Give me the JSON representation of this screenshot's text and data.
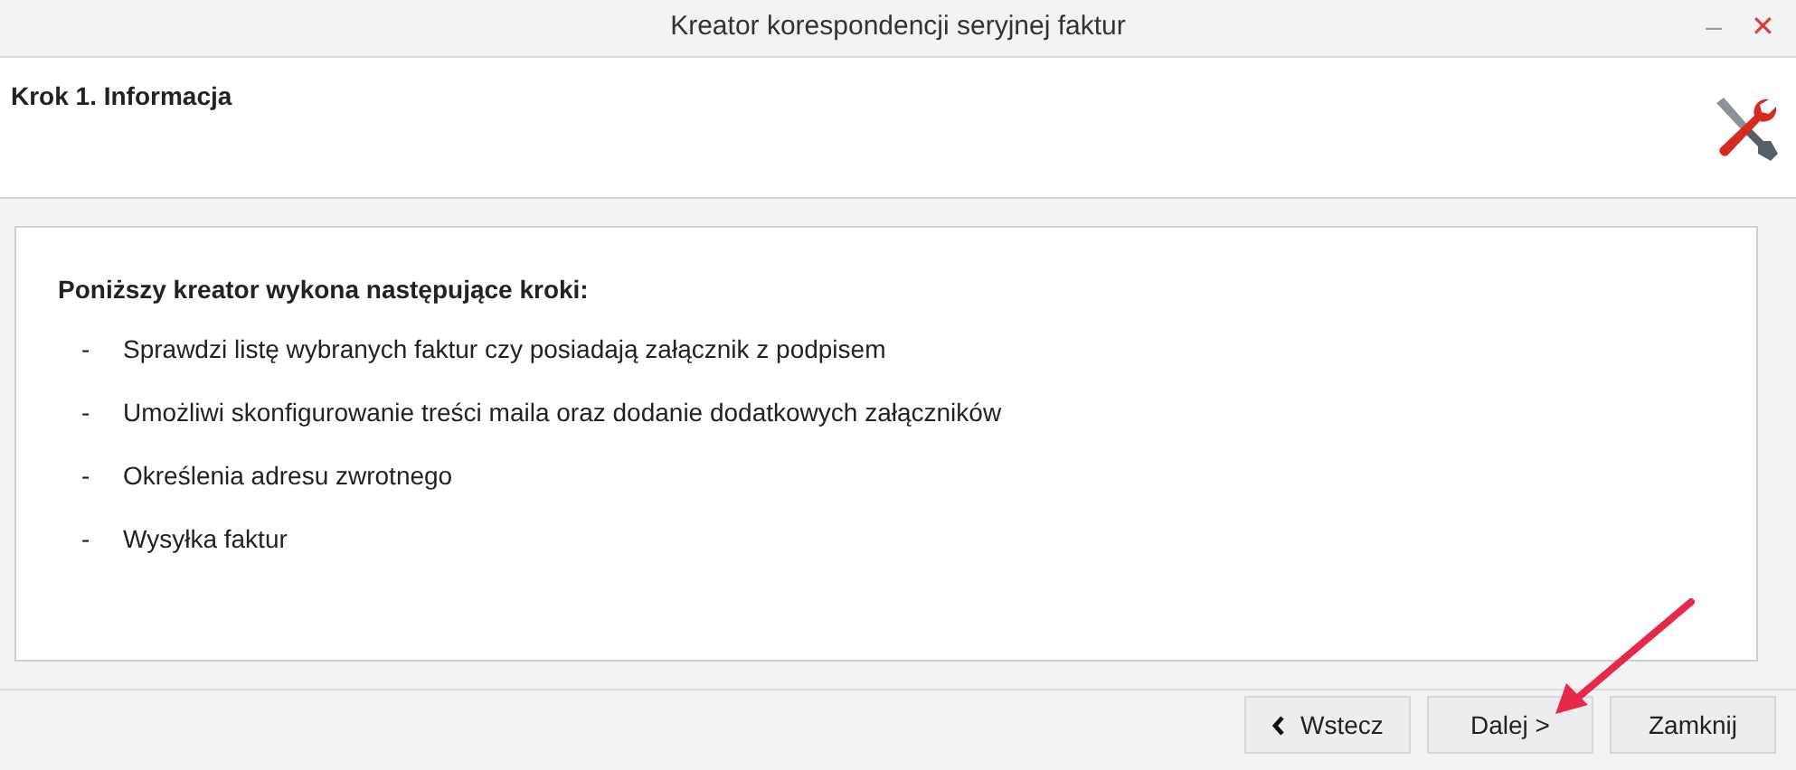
{
  "window": {
    "title": "Kreator korespondencji seryjnej faktur",
    "controls": [
      "–",
      "✕"
    ]
  },
  "step": {
    "title": "Krok 1. Informacja"
  },
  "content": {
    "heading": "Poniższy kreator wykona następujące kroki:",
    "items": [
      {
        "bullet": "-",
        "text": "Sprawdzi listę wybranych faktur czy posiadają załącznik z podpisem"
      },
      {
        "bullet": "-",
        "text": "Umożliwi skonfigurowanie treści maila oraz dodanie dodatkowych załączników"
      },
      {
        "bullet": "-",
        "text": "Określenia adresu zwrotnego"
      },
      {
        "bullet": "-",
        "text": "Wysyłka faktur"
      }
    ]
  },
  "buttons": [
    {
      "label": "Wstecz",
      "kind": "back"
    },
    {
      "label": "Dalej >",
      "kind": "plain"
    },
    {
      "label": "Zamknij",
      "kind": "plain"
    }
  ]
}
